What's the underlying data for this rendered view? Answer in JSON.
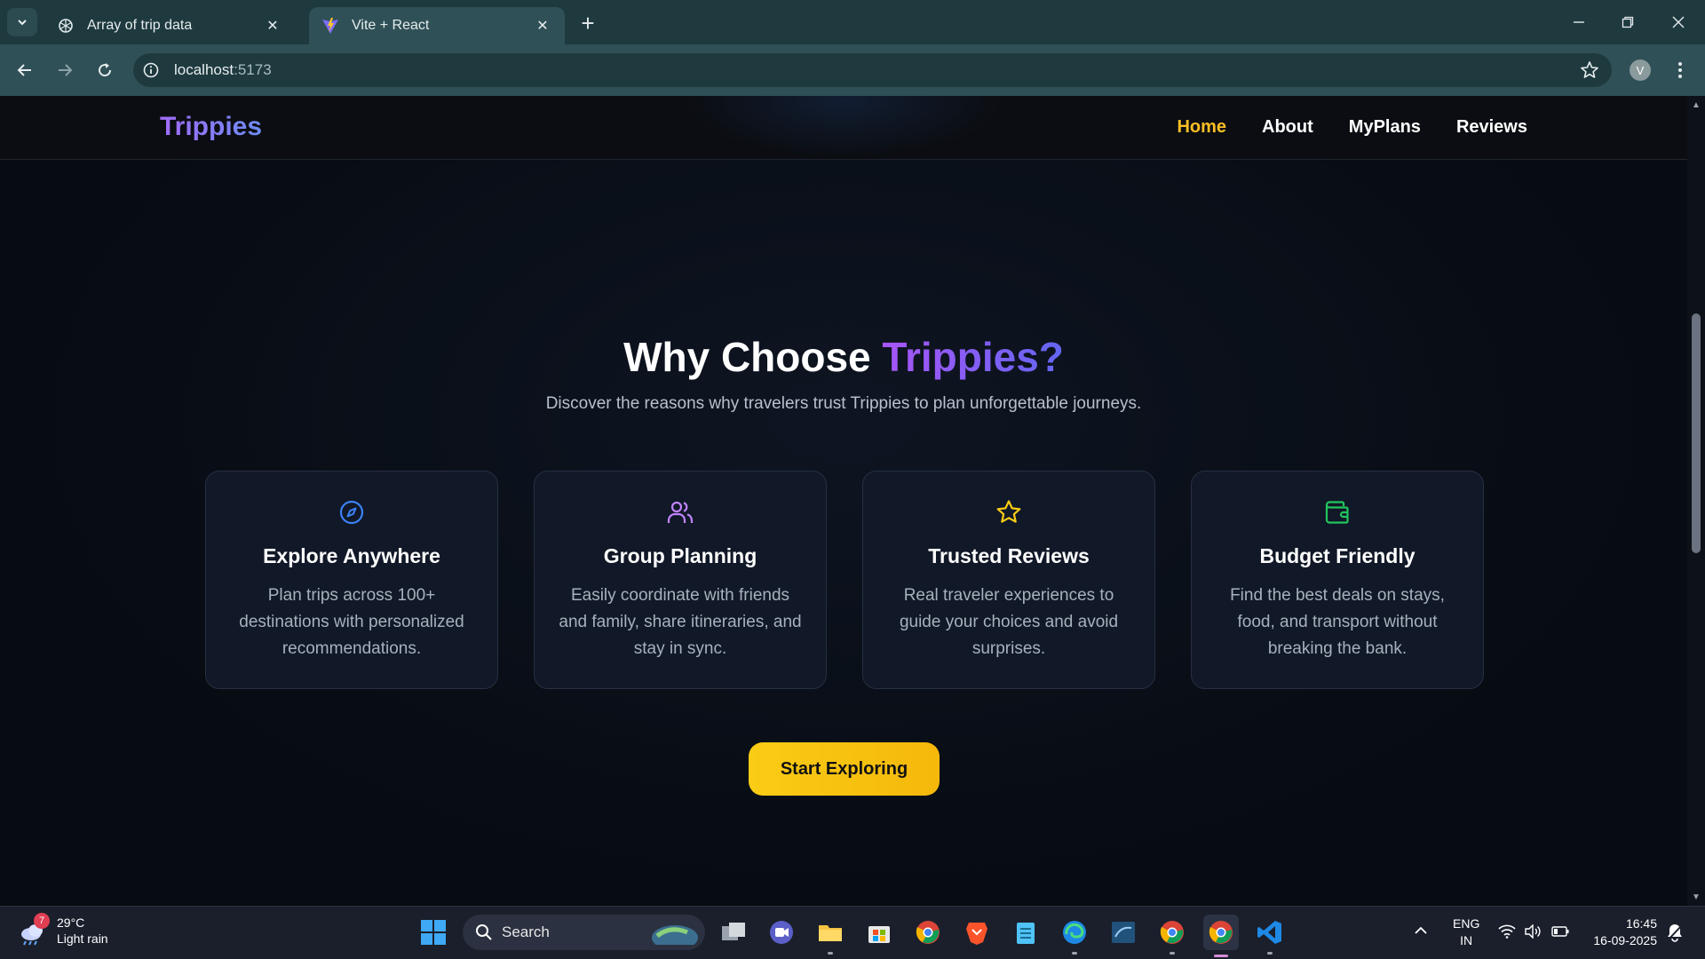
{
  "browser": {
    "tabs": [
      {
        "title": "Array of trip data",
        "favicon": "openai-icon",
        "active": false
      },
      {
        "title": "Vite + React",
        "favicon": "vite-icon",
        "active": true
      }
    ],
    "url_host": "localhost",
    "url_port": ":5173",
    "profile_initial": "V"
  },
  "site": {
    "logo": "Trippies",
    "nav": [
      {
        "label": "Home",
        "active": true
      },
      {
        "label": "About",
        "active": false
      },
      {
        "label": "MyPlans",
        "active": false
      },
      {
        "label": "Reviews",
        "active": false
      }
    ],
    "heading_prefix": "Why Choose ",
    "heading_brand": "Trippies?",
    "subheading": "Discover the reasons why travelers trust Trippies to plan unforgettable journeys.",
    "features": [
      {
        "icon": "compass-icon",
        "icon_color": "#3b82f6",
        "title": "Explore Anywhere",
        "description": "Plan trips across 100+ destinations with personalized recommendations."
      },
      {
        "icon": "users-icon",
        "icon_color": "#c084fc",
        "title": "Group Planning",
        "description": "Easily coordinate with friends and family, share itineraries, and stay in sync."
      },
      {
        "icon": "star-icon",
        "icon_color": "#facc15",
        "title": "Trusted Reviews",
        "description": "Real traveler experiences to guide your choices and avoid surprises."
      },
      {
        "icon": "wallet-icon",
        "icon_color": "#22c55e",
        "title": "Budget Friendly",
        "description": "Find the best deals on stays, food, and transport without breaking the bank."
      }
    ],
    "cta_label": "Start Exploring",
    "accent_color": "#fbbf24"
  },
  "taskbar": {
    "weather": {
      "temp": "29°C",
      "condition": "Light rain",
      "badge": "7"
    },
    "search_label": "Search",
    "language": {
      "line1": "ENG",
      "line2": "IN"
    },
    "time": "16:45",
    "date": "16-09-2025"
  }
}
